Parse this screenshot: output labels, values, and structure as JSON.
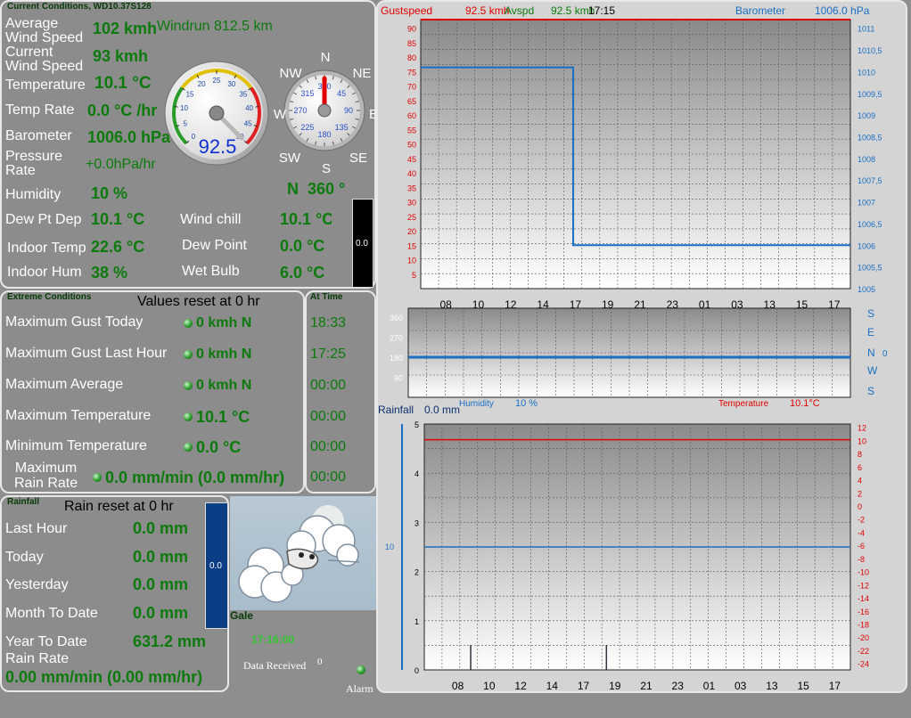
{
  "current": {
    "title": "Current Conditions, WD10.37S128",
    "avg_wind_label": "Average\nWind Speed",
    "avg_wind_value": "102 kmh",
    "windrun": "Windrun 812.5 km",
    "cur_wind_label": "Current\nWind Speed",
    "cur_wind_value": "93 kmh",
    "temperature_label": "Temperature",
    "temperature_value": "10.1 °C",
    "temp_rate_label": "Temp Rate",
    "temp_rate_value": "0.0 °C /hr",
    "barometer_label": "Barometer",
    "barometer_value": "1006.0 hPa",
    "pressure_rate_label": "Pressure\nRate",
    "pressure_rate_value": "+0.0hPa/hr",
    "humidity_label": "Humidity",
    "humidity_value": "10 %",
    "direction_value": "N  360 °",
    "dewpt_dep_label": "Dew Pt Dep",
    "dewpt_dep_value": "10.1 °C",
    "indoor_temp_label": "Indoor Temp",
    "indoor_temp_value": "22.6 °C",
    "indoor_hum_label": "Indoor Hum",
    "indoor_hum_value": "38 %",
    "wind_chill_label": "Wind chill",
    "wind_chill_value": "10.1 °C",
    "dew_point_label": "Dew Point",
    "dew_point_value": "0.0 °C",
    "wet_bulb_label": "Wet Bulb",
    "wet_bulb_value": "6.0 °C",
    "side_bar_value": "0.0",
    "speed_gauge": {
      "value": 92.5,
      "display": "92.5",
      "ticks": [
        "0",
        "5",
        "10",
        "15",
        "20",
        "25",
        "30",
        "35",
        "40",
        "45",
        "50"
      ]
    },
    "compass": {
      "N": "N",
      "NE": "NE",
      "E": "E",
      "SE": "SE",
      "S": "S",
      "SW": "SW",
      "W": "W",
      "NW": "NW",
      "ticks": [
        "360",
        "45",
        "90",
        "135",
        "180",
        "225",
        "270",
        "315"
      ],
      "bearing": 360
    }
  },
  "extreme": {
    "title": "Extreme Conditions",
    "reset": "Values reset at 0 hr",
    "at_time_title": "At Time",
    "rows": [
      {
        "label": "Maximum Gust Today",
        "value": "0 kmh N",
        "time": "18:33"
      },
      {
        "label": "Maximum Gust Last Hour",
        "value": "0 kmh N",
        "time": "17:25"
      },
      {
        "label": "Maximum Average",
        "value": "0 kmh N",
        "time": "00:00"
      },
      {
        "label": "Maximum Temperature",
        "value": "10.1 °C",
        "time": "00:00"
      },
      {
        "label": "Minimum Temperature",
        "value": "0.0 °C",
        "time": "00:00"
      },
      {
        "label": "Maximum\nRain Rate",
        "value": "0.0 mm/min (0.0 mm/hr)",
        "time": "00:00"
      }
    ]
  },
  "rain": {
    "title": "Rainfall",
    "reset": "Rain reset at 0 hr",
    "rows": [
      {
        "label": "Last Hour",
        "value": "0.0 mm"
      },
      {
        "label": "Today",
        "value": "0.0 mm"
      },
      {
        "label": "Yesterday",
        "value": "0.0 mm"
      },
      {
        "label": "Month To Date",
        "value": "0.0 mm"
      },
      {
        "label": "Year To Date",
        "value": "631.2 mm"
      }
    ],
    "rate_label": "Rain Rate",
    "rate_value": "0.00 mm/min (0.00 mm/hr)",
    "bar_value": "0.0"
  },
  "status": {
    "condition": "Gale",
    "time": "17:16:00",
    "data_received_label": "Data Received",
    "data_received_value": "0",
    "alarm_label": "Alarm"
  },
  "colors": {
    "green": "#0c7a0c",
    "red": "#e00000",
    "blue": "#1a6fc4",
    "white": "#ffffff"
  },
  "chart_data": [
    {
      "type": "line",
      "header": {
        "gust_label": "Gustspeed",
        "gust_value": "92.5 kmh",
        "avg_label": "Avspd",
        "avg_value": "92.5 kmh",
        "time": "17:15",
        "baro_label": "Barometer",
        "baro_value": "1006.0 hPa"
      },
      "x_ticks": [
        "08",
        "10",
        "12",
        "14",
        "17",
        "19",
        "21",
        "23",
        "01",
        "03",
        "13",
        "15",
        "17"
      ],
      "y_left_ticks": [
        "5",
        "10",
        "15",
        "20",
        "25",
        "30",
        "35",
        "40",
        "45",
        "50",
        "55",
        "60",
        "65",
        "70",
        "75",
        "80",
        "85",
        "90"
      ],
      "y_left_lim": [
        0,
        93
      ],
      "y_right_ticks": [
        "1005",
        "1005,5",
        "1006",
        "1006,5",
        "1007",
        "1007,5",
        "1008",
        "1008,5",
        "1009",
        "1009,5",
        "1010",
        "1010,5",
        "1011"
      ],
      "y_right_lim": [
        1005,
        1011.2
      ],
      "series": [
        {
          "axis": "right",
          "color": "#1a6fc4",
          "points": [
            [
              0,
              1010.1
            ],
            [
              4.4,
              1010.1
            ],
            [
              4.4,
              1006.0
            ],
            [
              12.4,
              1006.0
            ]
          ]
        },
        {
          "axis": "left",
          "color": "#e00000",
          "points": [
            [
              0,
              93
            ],
            [
              12.4,
              93
            ]
          ]
        }
      ]
    },
    {
      "type": "line",
      "y_ticks": [
        "90",
        "180",
        "270",
        "360"
      ],
      "y_lim": [
        0,
        400
      ],
      "dir_labels": [
        "S",
        "E",
        "N",
        "0",
        "W",
        "S"
      ],
      "series": [
        {
          "color": "#1a6fc4",
          "value": 180
        }
      ]
    },
    {
      "type": "line",
      "header": {
        "rain_label": "Rainfall",
        "rain_value": "0.0 mm",
        "hum_label": "Humidity",
        "hum_value": "10 %",
        "temp_label": "Temperature",
        "temp_value": "10.1°C"
      },
      "x_ticks": [
        "08",
        "10",
        "12",
        "14",
        "17",
        "19",
        "21",
        "23",
        "01",
        "03",
        "13",
        "15",
        "17"
      ],
      "y_left_ticks": [
        "0",
        "1",
        "2",
        "3",
        "4",
        "5"
      ],
      "y_left_lim": [
        0,
        5
      ],
      "y_right_ticks": [
        "-24",
        "-22",
        "-20",
        "-18",
        "-16",
        "-14",
        "-12",
        "-10",
        "-8",
        "-6",
        "-4",
        "-2",
        "0",
        "2",
        "4",
        "6",
        "8",
        "10",
        "12"
      ],
      "y_right_lim": [
        -25,
        12.5
      ],
      "outer_left_tick": "10",
      "series": [
        {
          "axis": "right",
          "color": "#e00000",
          "value": 10.1
        },
        {
          "axis": "left",
          "color": "#1a6fc4",
          "value": 2.5
        }
      ],
      "spikes": [
        1.35,
        5.3
      ]
    }
  ]
}
